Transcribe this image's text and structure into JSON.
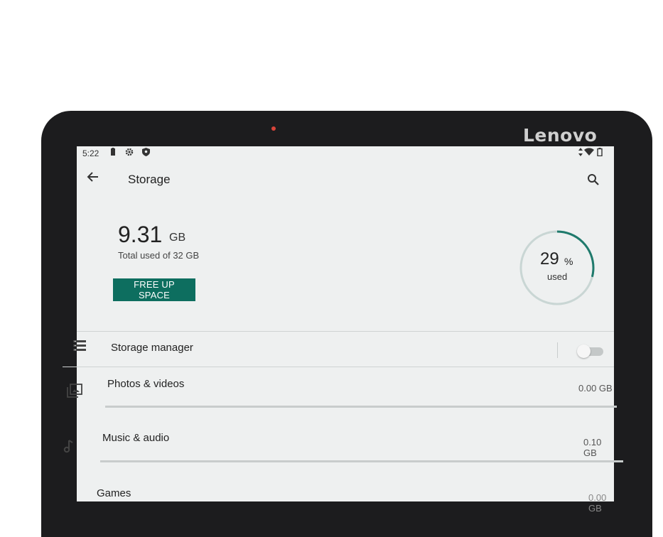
{
  "device": {
    "brand": "Lenovo"
  },
  "status_bar": {
    "time": "5:22"
  },
  "toolbar": {
    "title": "Storage"
  },
  "summary": {
    "used_value": "9.31",
    "used_unit": "GB",
    "total_text": "Total used of 32 GB",
    "free_button_label": "FREE UP SPACE",
    "percent_value": "29",
    "percent_symbol": "%",
    "percent_label": "used",
    "percent_fraction": 0.29
  },
  "storage_manager": {
    "label": "Storage manager",
    "enabled": false
  },
  "categories": [
    {
      "label": "Photos & videos",
      "value": "0.00 GB",
      "icon": "photo-library-icon"
    },
    {
      "label": "Music & audio",
      "value": "0.10 GB",
      "icon": "music-note-icon"
    },
    {
      "label": "Games",
      "value": "0.00 GB",
      "icon": "games-icon"
    }
  ],
  "colors": {
    "accent": "#0d6e5f",
    "ring": "#1f7a6c",
    "ring_track": "#c9d6d4"
  }
}
